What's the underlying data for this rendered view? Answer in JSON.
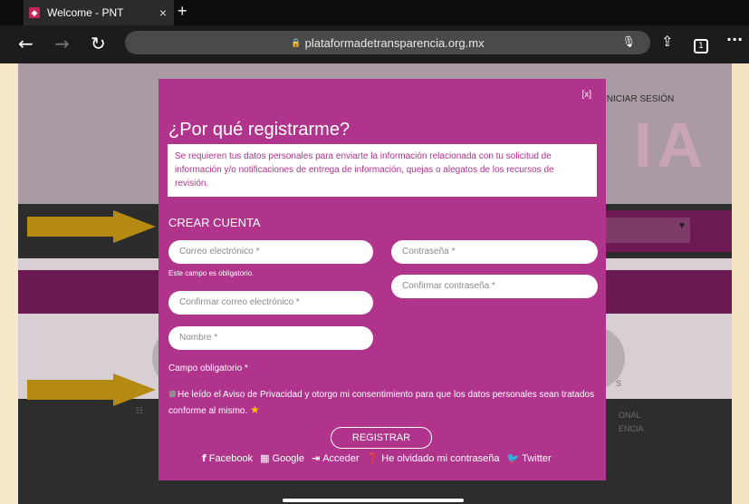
{
  "browser": {
    "tab_title": "Welcome - PNT",
    "tab_close": "×",
    "new_tab": "+",
    "url": "plataformadetransparencia.org.mx",
    "tabs_count": "1"
  },
  "background": {
    "login_link": "INICIAR SESIÓN"
  },
  "modal": {
    "close_label": "[x]",
    "title": "¿Por qué registrarme?",
    "info_text": "Se requieren tus datos personales para enviarte la información relacionada con tu solicitud de información y/o notificaciones de entrega de información, quejas o alegatos de los recursos de revisión.",
    "section_title": "CREAR CUENTA",
    "fields": {
      "email_placeholder": "Correo electrónico *",
      "password_placeholder": "Contraseña *",
      "confirm_email_placeholder": "Confirmar correo electrónico *",
      "confirm_password_placeholder": "Confirmar contraseña *",
      "name_placeholder": "Nombre *"
    },
    "email_error": "Este campo es obligatorio.",
    "required_note": "Campo obligatorio *",
    "privacy_text": "He leído el Aviso de Privacidad y otorgo mi consentimiento para que los datos personales sean tratados conforme al mismo.",
    "privacy_star": "★",
    "register_button": "REGISTRAR",
    "social": {
      "facebook": "Facebook",
      "google": "Google",
      "acceder": "Acceder",
      "forgot": "He olvidado mi contraseña",
      "twitter": "Twitter"
    }
  },
  "colors": {
    "modal_bg": "#b0338c",
    "arrow": "#b48a12",
    "star": "#f5c200"
  }
}
